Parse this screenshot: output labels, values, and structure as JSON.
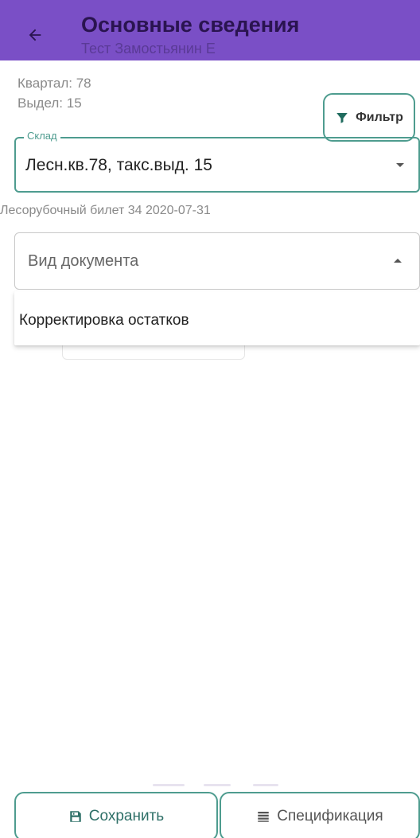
{
  "appbar": {
    "title": "Основные сведения",
    "subtitle": "Тест Замостьянин Е",
    "back_icon": "arrow-left-icon"
  },
  "info": {
    "kvartal": "Квартал: 78",
    "vydel": "Выдел: 15"
  },
  "filter_button": {
    "label": "Фильтр",
    "icon": "funnel-icon"
  },
  "sklad": {
    "legend": "Склад",
    "value": "Лесн.кв.78, такс.выд. 15"
  },
  "ticket": {
    "text": "Лесорубочный билет 34 2020-07-31"
  },
  "document_type": {
    "placeholder": "Вид документа",
    "options": [
      "Корректировка остатков"
    ]
  },
  "bottom_bar": {
    "save_label": "Сохранить",
    "save_icon": "floppy-disk-icon",
    "spec_label": "Спецификация",
    "spec_icon": "list-icon"
  },
  "colors": {
    "appbar": "#7a4fc6",
    "accent": "#4e9c8f",
    "title_text": "#2a1450"
  }
}
